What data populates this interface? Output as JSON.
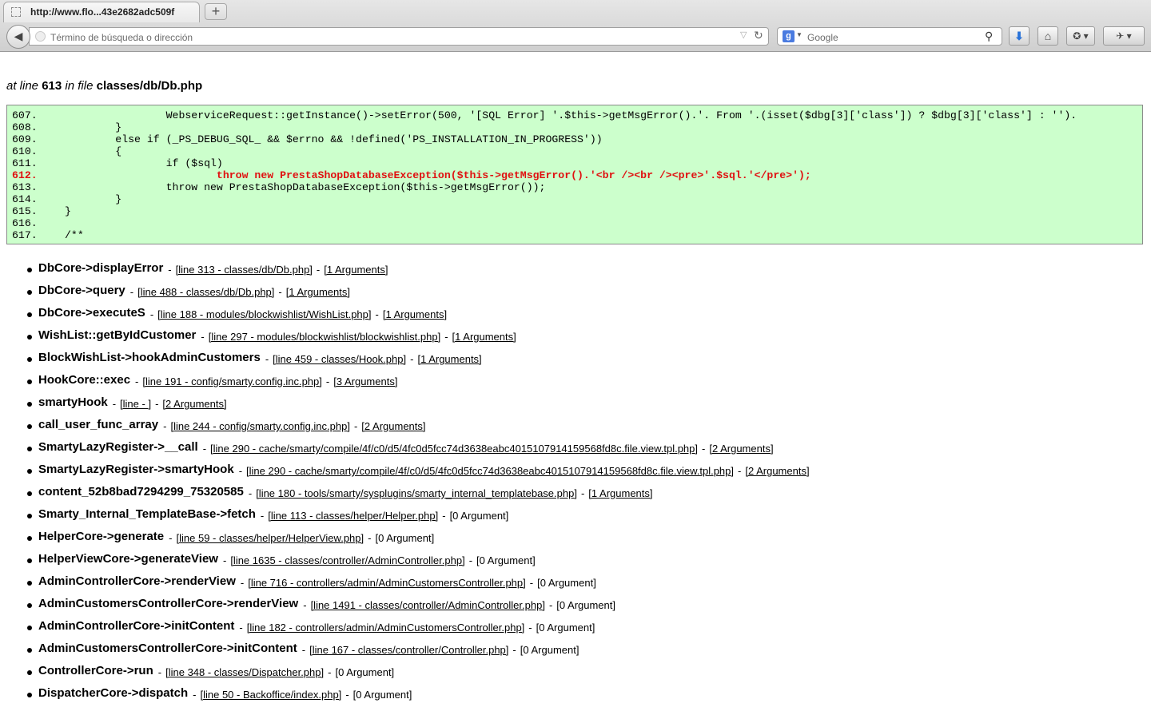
{
  "browser": {
    "tab_title": "http://www.flo...43e2682adc509f",
    "new_tab_label": "+",
    "address_placeholder": "Término de búsqueda o dirección",
    "search_placeholder": "Google",
    "search_engine_icon": "google-icon"
  },
  "error": {
    "at_line_text": "at line",
    "line_number": "613",
    "in_file_text": "in file",
    "file": "classes/db/Db.php"
  },
  "code_lines": [
    {
      "num": "607.",
      "code": "                WebserviceRequest::getInstance()->setError(500, '[SQL Error] '.$this->getMsgError().'. From '.(isset($dbg[3]['class']) ? $dbg[3]['class'] : '').",
      "highlight": false
    },
    {
      "num": "608.",
      "code": "        }",
      "highlight": false
    },
    {
      "num": "609.",
      "code": "        else if (_PS_DEBUG_SQL_ && $errno && !defined('PS_INSTALLATION_IN_PROGRESS'))",
      "highlight": false
    },
    {
      "num": "610.",
      "code": "        {",
      "highlight": false
    },
    {
      "num": "611.",
      "code": "                if ($sql)",
      "highlight": false
    },
    {
      "num": "612.",
      "code": "                        throw new PrestaShopDatabaseException($this->getMsgError().'<br /><br /><pre>'.$sql.'</pre>');",
      "highlight": true
    },
    {
      "num": "613.",
      "code": "                throw new PrestaShopDatabaseException($this->getMsgError());",
      "highlight": false
    },
    {
      "num": "614.",
      "code": "        }",
      "highlight": false
    },
    {
      "num": "615.",
      "code": "}",
      "highlight": false
    },
    {
      "num": "616.",
      "code": "",
      "highlight": false
    },
    {
      "num": "617.",
      "code": "/**",
      "highlight": false
    }
  ],
  "separator": "-",
  "stack_trace": [
    {
      "fn": "DbCore->displayError",
      "line": "[line 313 - classes/db/Db.php]",
      "args": "[1 Arguments]",
      "args_link": true
    },
    {
      "fn": "DbCore->query",
      "line": "[line 488 - classes/db/Db.php]",
      "args": "[1 Arguments]",
      "args_link": true
    },
    {
      "fn": "DbCore->executeS",
      "line": "[line 188 - modules/blockwishlist/WishList.php]",
      "args": "[1 Arguments]",
      "args_link": true
    },
    {
      "fn": "WishList::getByIdCustomer",
      "line": "[line 297 - modules/blockwishlist/blockwishlist.php]",
      "args": "[1 Arguments]",
      "args_link": true
    },
    {
      "fn": "BlockWishList->hookAdminCustomers",
      "line": "[line 459 - classes/Hook.php]",
      "args": "[1 Arguments]",
      "args_link": true
    },
    {
      "fn": "HookCore::exec",
      "line": "[line 191 - config/smarty.config.inc.php]",
      "args": "[3 Arguments]",
      "args_link": true
    },
    {
      "fn": "smartyHook",
      "line": "[line - ]",
      "args": "[2 Arguments]",
      "args_link": true
    },
    {
      "fn": "call_user_func_array",
      "line": "[line 244 - config/smarty.config.inc.php]",
      "args": "[2 Arguments]",
      "args_link": true
    },
    {
      "fn": "SmartyLazyRegister->__call",
      "line": "[line 290 - cache/smarty/compile/4f/c0/d5/4fc0d5fcc74d3638eabc4015107914159568fd8c.file.view.tpl.php]",
      "args": "[2 Arguments]",
      "args_link": true
    },
    {
      "fn": "SmartyLazyRegister->smartyHook",
      "line": "[line 290 - cache/smarty/compile/4f/c0/d5/4fc0d5fcc74d3638eabc4015107914159568fd8c.file.view.tpl.php]",
      "args": "[2 Arguments]",
      "args_link": true
    },
    {
      "fn": "content_52b8bad7294299_75320585",
      "line": "[line 180 - tools/smarty/sysplugins/smarty_internal_templatebase.php]",
      "args": "[1 Arguments]",
      "args_link": true
    },
    {
      "fn": "Smarty_Internal_TemplateBase->fetch",
      "line": "[line 113 - classes/helper/Helper.php]",
      "args": "[0 Argument]",
      "args_link": false
    },
    {
      "fn": "HelperCore->generate",
      "line": "[line 59 - classes/helper/HelperView.php]",
      "args": "[0 Argument]",
      "args_link": false
    },
    {
      "fn": "HelperViewCore->generateView",
      "line": "[line 1635 - classes/controller/AdminController.php]",
      "args": "[0 Argument]",
      "args_link": false
    },
    {
      "fn": "AdminControllerCore->renderView",
      "line": "[line 716 - controllers/admin/AdminCustomersController.php]",
      "args": "[0 Argument]",
      "args_link": false
    },
    {
      "fn": "AdminCustomersControllerCore->renderView",
      "line": "[line 1491 - classes/controller/AdminController.php]",
      "args": "[0 Argument]",
      "args_link": false
    },
    {
      "fn": "AdminControllerCore->initContent",
      "line": "[line 182 - controllers/admin/AdminCustomersController.php]",
      "args": "[0 Argument]",
      "args_link": false
    },
    {
      "fn": "AdminCustomersControllerCore->initContent",
      "line": "[line 167 - classes/controller/Controller.php]",
      "args": "[0 Argument]",
      "args_link": false
    },
    {
      "fn": "ControllerCore->run",
      "line": "[line 348 - classes/Dispatcher.php]",
      "args": "[0 Argument]",
      "args_link": false
    },
    {
      "fn": "DispatcherCore->dispatch",
      "line": "[line 50 - Backoffice/index.php]",
      "args": "[0 Argument]",
      "args_link": false
    }
  ],
  "colors": {
    "code_background": "#ccffcc",
    "highlight_line": "#e01010"
  }
}
